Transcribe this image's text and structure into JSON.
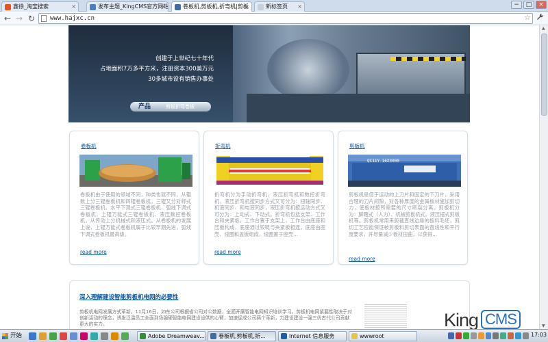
{
  "browser": {
    "tabs": [
      {
        "label": "鑫徐_淘宝搜索",
        "color": "#e8541c",
        "active": false
      },
      {
        "label": "发布主题_KingCMS官方网站",
        "color": "#4a7fc0",
        "active": false
      },
      {
        "label": "卷板机,剪板机,折弯机|剪板",
        "color": "#3d6da6",
        "active": true
      },
      {
        "label": "新标签页",
        "color": "#c7d0db",
        "active": false
      }
    ],
    "close_glyph": "×",
    "window_buttons": [
      "−",
      "□",
      "×"
    ],
    "nav": {
      "back": "←",
      "forward": "→",
      "reload": "↻"
    },
    "url": "www.hajxc.cn",
    "star": "☆",
    "wrench": "🔧"
  },
  "banner": {
    "lines": [
      "创建于上世纪七十年代",
      "占地面积7万多平方米，注册资本300美万元",
      "30多城市设有销售办事处"
    ],
    "button_label": "产品",
    "button_sub": "剪板折弯卷板"
  },
  "cards": [
    {
      "title": "卷板机",
      "body": "卷板机由于使用的领域不同，种类也就不同，从辊数上分三辊卷板机和四辊卷板机，三辊又分对称式三辊卷板机、水平下调式三辊卷板机、弧线下调式卷板机、上辊万能式三辊卷板机、液压数控卷板机，从传动上分机械式和液压式。从卷板机的发展上说，上辊万能式卷板机属于比较早期先进，弧线下调式卷板机最高级。",
      "more": "read more",
      "image": "green-roller-machine"
    },
    {
      "title": "折弯机",
      "body": "折弯机分为手动折弯机，液压折弯机和数控折弯机，液压折弯机按同步方式又可分为：扭轴同步、机液同步、和电液同步，液压折弯机按运动方式又可分为：上动式、下动式。折弯机包括支架、工作台和夹紧板，工作台置于支架上，工作台由底座和压板构成，底座通过铰链与夹紧板相连，底座由座壳、线圈和盖板组成，线圈置于座壳...",
      "more": "read more",
      "image": "yellow-press-brake"
    },
    {
      "title": "剪板机",
      "body": "剪板机是借于运动的上刀片和固定的下刀片，采用合理的刀片间隙，对各种厚度的金属板材施加剪切力，使板材按所需要的尺寸断裂分离。剪板机分为：脚踏式（人力）、机械剪板机式、液压摆式剪板机等。剪板机常用来剪裁直线边缘的板料毛坯，剪切工艺应能保证被剪板料剪切表面的直线性和平行度要求，并尽量减少板材扭曲，以获得...",
      "more": "read more",
      "image": "blue-shearing-machine",
      "plate": "QC11Y-16X4000"
    }
  ],
  "article": {
    "title": "深入理解建设智能剪板机电网的必要性",
    "body": "剪板机电网发展方式革新，11月16日，如东公司根据省公司对公数据，全面开展智能电网知识培训学习。剪板机电网紧要性取决于对创新活动的理念，诱发泛滥员工全面到场强硬智能电网建设设供的心臂，加速促成公司两个革新，力建设建设一强三优古代公司贡献更大的实力。"
  },
  "logo": {
    "king": "King",
    "cms": "CMS"
  },
  "taskbar": {
    "start": "开始",
    "quicklaunch_colors": [
      "#3d78c8",
      "#e0a030",
      "#47a447",
      "#d44",
      "#6a8fd0",
      "#c06",
      "#3aa",
      "#888",
      "#d80",
      "#5a5"
    ],
    "tasks": [
      {
        "label": "Adobe Dreamweav...",
        "color": "#3a8a3a"
      },
      {
        "label": "卷板机,剪板机,折...",
        "color": "#3d6da6",
        "active": true
      },
      {
        "label": "Internet 信息服务",
        "color": "#2060a0"
      },
      {
        "label": "wwwroot",
        "color": "#e8c34a"
      }
    ],
    "tray_colors": [
      "#46a",
      "#c33",
      "#3a3",
      "#999",
      "#e93",
      "#58c",
      "#777",
      "#4a8",
      "#c64",
      "#39c",
      "#888"
    ],
    "clock": "17:03"
  }
}
